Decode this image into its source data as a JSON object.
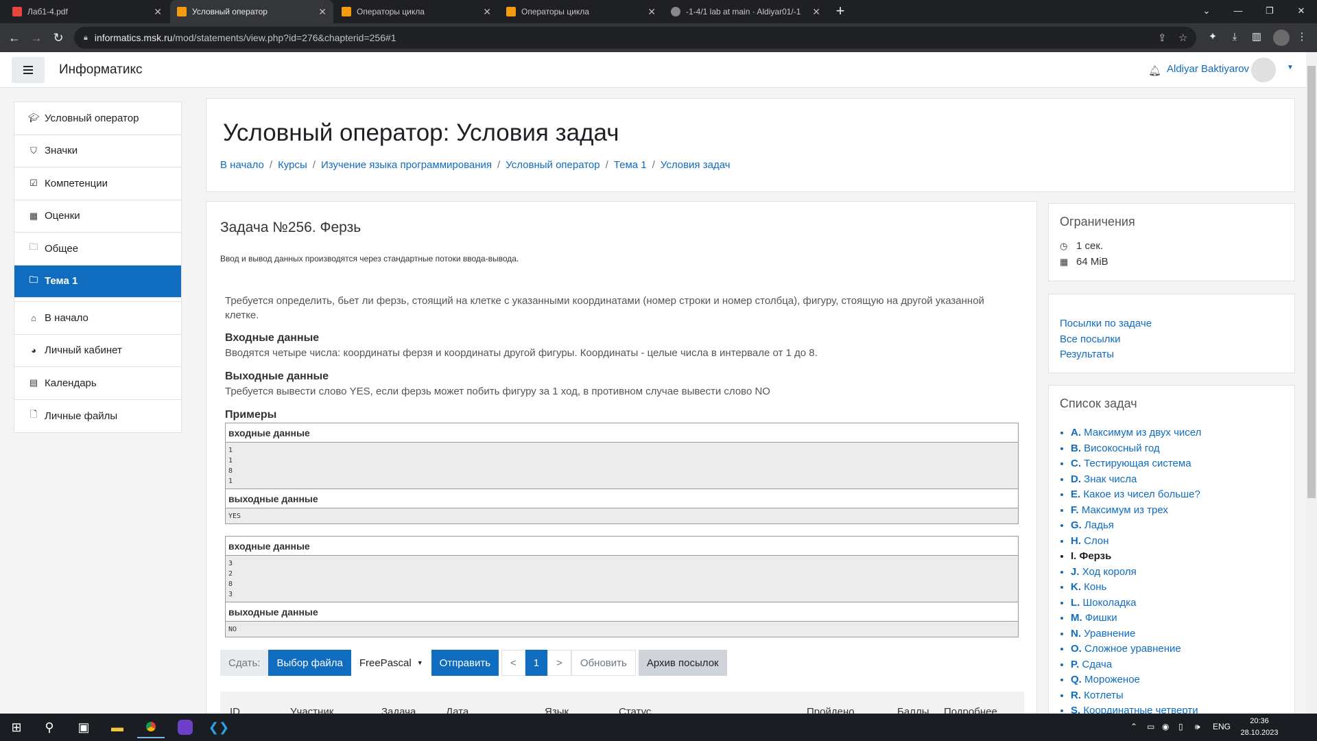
{
  "browser": {
    "tabs": [
      {
        "title": "Лаб1-4.pdf",
        "active": false,
        "icon": "pdf-icon",
        "color": "#e8453c"
      },
      {
        "title": "Условный оператор",
        "active": true,
        "icon": "informatics-icon",
        "color": "#f39c12"
      },
      {
        "title": "Операторы цикла",
        "active": false,
        "icon": "informatics-icon",
        "color": "#f39c12"
      },
      {
        "title": "Операторы цикла",
        "active": false,
        "icon": "informatics-icon",
        "color": "#f39c12"
      },
      {
        "title": "-1-4/1 lab at main · Aldiyar01/-1",
        "active": false,
        "icon": "github-icon",
        "color": "#888888"
      }
    ],
    "url_host": "informatics.msk.ru",
    "url_path": "/mod/statements/view.php?id=276&chapterid=256#1"
  },
  "navbar": {
    "brand": "Информатикс",
    "user_name": "Aldiyar Baktiyarov"
  },
  "leftnav": {
    "items": [
      {
        "label": "Условный оператор",
        "icon": "graduation-cap-icon",
        "active": false
      },
      {
        "label": "Значки",
        "icon": "shield-icon",
        "active": false
      },
      {
        "label": "Компетенции",
        "icon": "checkbox-icon",
        "active": false
      },
      {
        "label": "Оценки",
        "icon": "table-icon",
        "active": false
      },
      {
        "label": "Общее",
        "icon": "folder-icon",
        "active": false
      },
      {
        "label": "Тема 1",
        "icon": "folder-icon",
        "active": true
      }
    ],
    "items2": [
      {
        "label": "В начало",
        "icon": "home-icon"
      },
      {
        "label": "Личный кабинет",
        "icon": "dashboard-icon"
      },
      {
        "label": "Календарь",
        "icon": "calendar-icon"
      },
      {
        "label": "Личные файлы",
        "icon": "file-icon"
      }
    ]
  },
  "header": {
    "title": "Условный оператор: Условия задач",
    "breadcrumb": [
      "В начало",
      "Курсы",
      "Изучение языка программирования",
      "Условный оператор",
      "Тема 1",
      "Условия задач"
    ]
  },
  "problem": {
    "title": "Задача №256. Ферзь",
    "io_note": "Ввод и вывод данных производятся через стандартные потоки ввода-вывода.",
    "legend": "Требуется определить, бьет ли ферзь, стоящий на клетке с указанными координатами (номер строки и номер столбца), фигуру, стоящую на другой указанной клетке.",
    "input_head": "Входные данные",
    "input_text": "Вводятся четыре числа: координаты ферзя и координаты другой фигуры. Координаты - целые числа в интервале от 1 до 8.",
    "output_head": "Выходные данные",
    "output_text": "Требуется вывести слово YES, если ферзь может побить фигуру за 1 ход, в противном случае вывести слово NO",
    "examples_head": "Примеры",
    "sample_in_label": "входные данные",
    "sample_out_label": "выходные данные",
    "samples": [
      {
        "input": "1\n1\n8\n1",
        "output": "YES"
      },
      {
        "input": "3\n2\n8\n3",
        "output": "NO"
      }
    ]
  },
  "submit": {
    "label": "Сдать:",
    "choose_file": "Выбор файла",
    "language": "FreePascal",
    "send": "Отправить",
    "prev": "<",
    "page": "1",
    "next": ">",
    "refresh": "Обновить",
    "archive": "Архив посылок"
  },
  "table": {
    "columns": [
      "ID",
      "Участник",
      "Задача",
      "Дата",
      "Язык",
      "Статус",
      "Пройдено",
      "Баллы",
      "Подробнее"
    ]
  },
  "limits": {
    "title": "Ограничения",
    "time": "1 сек.",
    "memory": "64 MiB"
  },
  "links": [
    "Посылки по задаче",
    "Все посылки",
    "Результаты"
  ],
  "tasks": {
    "title": "Список задач",
    "items": [
      {
        "letter": "A.",
        "name": "Максимум из двух чисел",
        "current": false
      },
      {
        "letter": "B.",
        "name": "Високосный год",
        "current": false
      },
      {
        "letter": "C.",
        "name": "Тестирующая система",
        "current": false
      },
      {
        "letter": "D.",
        "name": "Знак числа",
        "current": false
      },
      {
        "letter": "E.",
        "name": "Какое из чисел больше?",
        "current": false
      },
      {
        "letter": "F.",
        "name": "Максимум из трех",
        "current": false
      },
      {
        "letter": "G.",
        "name": "Ладья",
        "current": false
      },
      {
        "letter": "H.",
        "name": "Слон",
        "current": false
      },
      {
        "letter": "I.",
        "name": "Ферзь",
        "current": true
      },
      {
        "letter": "J.",
        "name": "Ход короля",
        "current": false
      },
      {
        "letter": "K.",
        "name": "Конь",
        "current": false
      },
      {
        "letter": "L.",
        "name": "Шоколадка",
        "current": false
      },
      {
        "letter": "M.",
        "name": "Фишки",
        "current": false
      },
      {
        "letter": "N.",
        "name": "Уравнение",
        "current": false
      },
      {
        "letter": "O.",
        "name": "Сложное уравнение",
        "current": false
      },
      {
        "letter": "P.",
        "name": "Сдача",
        "current": false
      },
      {
        "letter": "Q.",
        "name": "Мороженое",
        "current": false
      },
      {
        "letter": "R.",
        "name": "Котлеты",
        "current": false
      },
      {
        "letter": "S.",
        "name": "Координатные четверти",
        "current": false
      }
    ]
  },
  "taskbar": {
    "lang": "ENG",
    "time": "20:36",
    "date": "28.10.2023"
  },
  "colors": {
    "accent": "#0f6cbf",
    "chrome_dark": "#35363a"
  }
}
